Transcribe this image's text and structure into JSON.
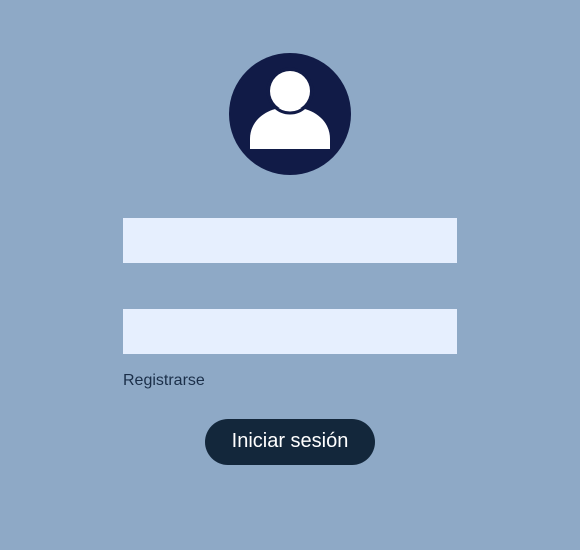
{
  "avatar": {
    "icon": "user-profile-icon",
    "background_color": "#111b47",
    "icon_color": "#ffffff"
  },
  "username_field": {
    "value": "",
    "placeholder": ""
  },
  "password_field": {
    "value": "",
    "placeholder": ""
  },
  "register_link": {
    "label": "Registrarse"
  },
  "login_button": {
    "label": "Iniciar sesión",
    "color": "#13273b"
  },
  "colors": {
    "background": "#8ea9c6",
    "field_background": "#e6effe"
  }
}
